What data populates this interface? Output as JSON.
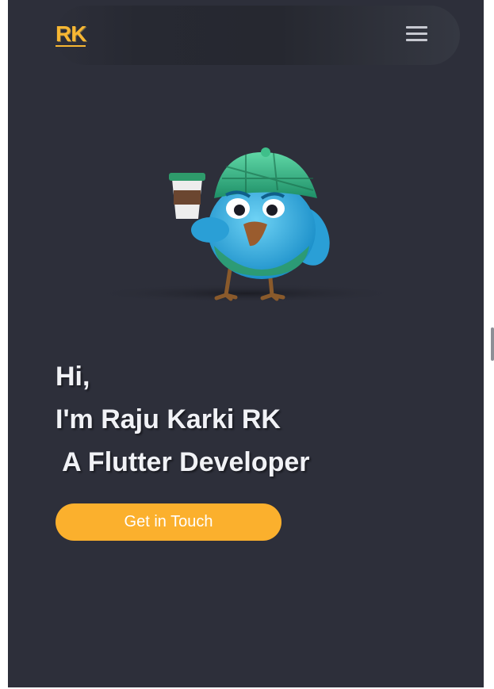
{
  "header": {
    "logo_text": "RK",
    "menu_icon": "hamburger-menu-icon"
  },
  "hero": {
    "illustration": "bird-holding-coffee-illustration",
    "greeting": "Hi,",
    "name_line": "I'm Raju Karki RK",
    "role_line": " A Flutter Developer",
    "cta_label": "Get in Touch"
  },
  "colors": {
    "accent": "#fbb02d",
    "background": "#2d2f3a",
    "text": "#f1f2f6"
  }
}
